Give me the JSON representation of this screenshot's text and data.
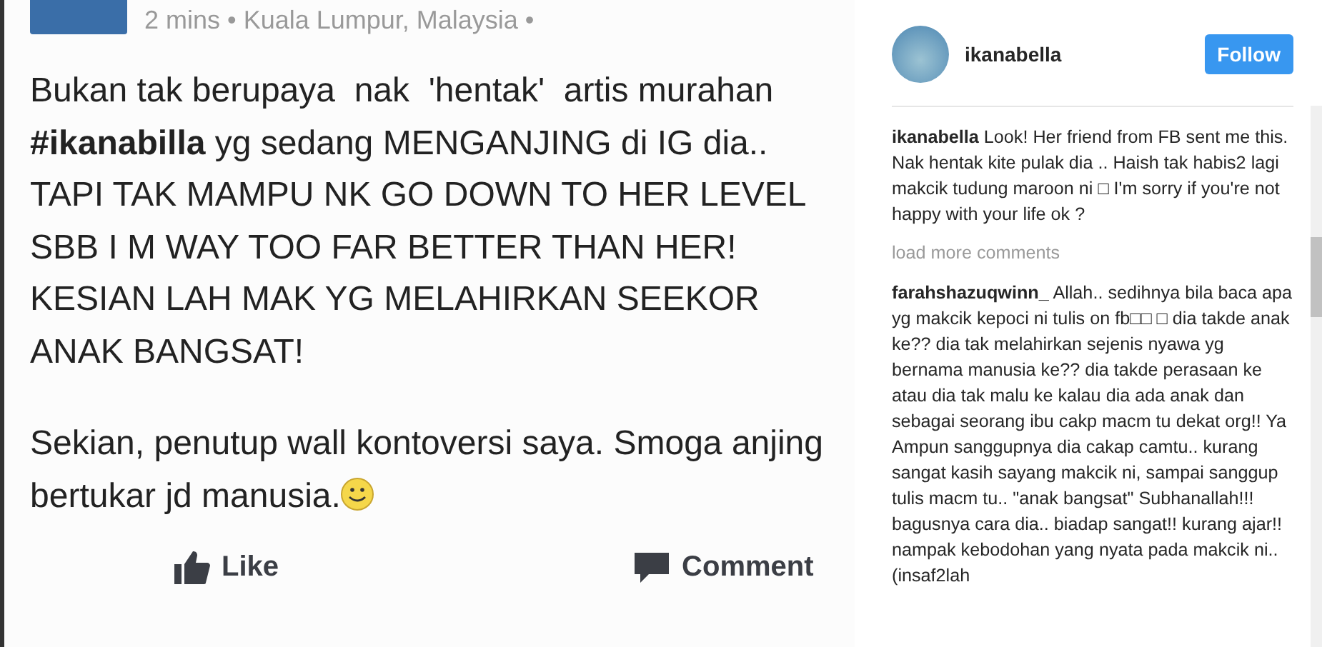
{
  "post_image": {
    "meta": "2 mins • Kuala Lumpur, Malaysia •",
    "paragraphs": [
      "Bukan tak berupaya  nak  'hentak'  artis murahan **#ikanabilla** yg sedang MENGANJING di IG dia.. TAPI TAK MAMPU NK GO DOWN TO HER LEVEL SBB I M WAY TOO FAR BETTER THAN HER! KESIAN LAH MAK YG MELAHIRKAN SEEKOR ANAK BANGSAT!",
      "Sekian, penutup wall kontoversi saya. Smoga anjing bertukar jd manusia."
    ],
    "actions": [
      {
        "kind": "like",
        "label": "Like"
      },
      {
        "kind": "comment",
        "label": "Comment"
      }
    ]
  },
  "header": {
    "username": "ikanabella",
    "follow": "Follow"
  },
  "caption": {
    "username": "ikanabella",
    "text": "Look! Her friend from FB sent me this. Nak hentak kite pulak dia .. Haish tak habis2 lagi makcik tudung maroon ni □ I'm sorry if you're not happy with your life ok ?"
  },
  "load_more": "load more comments",
  "comments": [
    {
      "username": "farahshazuqwinn_",
      "text": "Allah.. sedihnya bila baca apa yg makcik kepoci ni tulis on fb□□ □ dia takde anak ke?? dia tak melahirkan sejenis nyawa yg bernama manusia ke?? dia takde perasaan ke atau dia tak malu ke kalau dia ada anak dan sebagai seorang ibu cakp macm tu dekat org!! Ya Ampun sanggupnya dia cakap camtu.. kurang sangat kasih sayang makcik ni, sampai sanggup tulis macm tu.. \"anak bangsat\" Subhanallah!!! bagusnya cara dia.. biadap sangat!! kurang ajar!! nampak kebodohan yang nyata pada makcik ni.. (insaf2lah"
    }
  ]
}
